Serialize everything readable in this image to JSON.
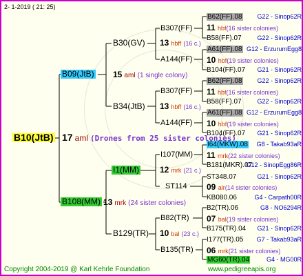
{
  "header": {
    "date_text": "2-   1-2019 ( 21:  25)"
  },
  "root": {
    "label": "B10(JtB)",
    "count": "17",
    "suffix": "aml",
    "note": "(Drones from 25 sister colonies)",
    "highlight": "#ffff33"
  },
  "level1": [
    {
      "label": "B09(JtB)",
      "count": "15",
      "suffix": "aml",
      "note": "(1 single colony)",
      "highlight": "#33ccff"
    },
    {
      "label": "B108(MM)",
      "count": "13",
      "suffix": "mrk",
      "note": "(24 sister colonies)",
      "highlight": "#33cc33"
    }
  ],
  "level2": [
    {
      "label": "B30(GV)"
    },
    {
      "label": "B34(JtB)"
    },
    {
      "label": "I1(MM)"
    },
    {
      "label": "B129(TR)"
    }
  ],
  "level3": [
    {
      "label": "B307(FF)"
    },
    {
      "label": "A144(FF)"
    },
    {
      "label": "B307(FF)"
    },
    {
      "label": "A144(FF)"
    },
    {
      "label": "I107(MM)"
    },
    {
      "label": "ST114"
    },
    {
      "label": "B82(TR)"
    },
    {
      "label": "B135(TR)"
    }
  ],
  "level3_counts": [
    {
      "count": "13",
      "suffix": "hbff",
      "note": "(16 c.)"
    },
    {
      "count": "15",
      "suffix": "aml",
      "note": "(1 single colony)"
    },
    {
      "count": "13",
      "suffix": "hbff",
      "note": "(16 c.)"
    },
    {
      "count": "12",
      "suffix": "mrk",
      "note": "(21 c.)"
    },
    {
      "count": "10",
      "suffix": "bal",
      "note": "(23 c.)"
    }
  ],
  "leaves": [
    {
      "label": "B62(FF).08",
      "highlight": "#aaaaaa",
      "right": "G22 - Sinop62R"
    },
    {
      "count": "11",
      "suffix": "hbf",
      "note": "(16 sister colonies)"
    },
    {
      "label": "B58(FF).07",
      "right": "G22 - Sinop62R"
    },
    {
      "label": "A61(FF).08",
      "highlight": "#aaaaaa",
      "right": "G12 - ErzurumEgg8"
    },
    {
      "count": "10",
      "suffix": "hbf",
      "note": "(19 sister colonies)"
    },
    {
      "label": "B104(FF).07",
      "right": "G21 - Sinop62R"
    },
    {
      "label": "B62(FF).08",
      "highlight": "#aaaaaa",
      "right": "G22 - Sinop62R"
    },
    {
      "count": "11",
      "suffix": "hbf",
      "note": "(16 sister colonies)"
    },
    {
      "label": "B58(FF).07",
      "right": "G22 - Sinop62R"
    },
    {
      "label": "A61(FF).08",
      "highlight": "#aaaaaa",
      "right": "G12 - ErzurumEgg8"
    },
    {
      "count": "10",
      "suffix": "hbf",
      "note": "(19 sister colonies)"
    },
    {
      "label": "B104(FF).07",
      "right": "G21 - Sinop62R"
    },
    {
      "label": "I64(MKW).08",
      "highlight": "#33ccff",
      "right": "G8 - Takab93aR"
    },
    {
      "count": "11",
      "suffix": "mrk",
      "note": "(22 sister colonies)"
    },
    {
      "label": "B181(MKR).07",
      "right": "G12 - SinopEgg86R"
    },
    {
      "label": "ST348.07",
      "right": "G21 - Sinop62R"
    },
    {
      "count": "09",
      "suffix": "alr",
      "note": "(14 sister colonies)"
    },
    {
      "label": "KB080.06",
      "right": "G4 - Carpath00R"
    },
    {
      "label": "B2(TR).06",
      "right": "G8 - NO6294R"
    },
    {
      "count": "07",
      "suffix": "bal",
      "note": "(19 sister colonies)"
    },
    {
      "label": "B175(TR).04",
      "right": "G21 - Sinop62R"
    },
    {
      "label": "I177(TR).05",
      "right": "G7 - Takab93aR"
    },
    {
      "count": "06",
      "suffix": "mrk",
      "note": "(21 sister colonies)"
    },
    {
      "label": "MG60(TR).04",
      "highlight": "#33cc33",
      "right": "G4 - MG00R"
    }
  ],
  "footer": {
    "copyright": "Copyright 2004-2019 @ Karl Kehrle Foundation",
    "url": "www.pedigreeapis.org"
  },
  "colors": {
    "border": "#cc00cc",
    "line": "#000000",
    "blue_text": "#0000cc",
    "green_text": "#008800"
  }
}
